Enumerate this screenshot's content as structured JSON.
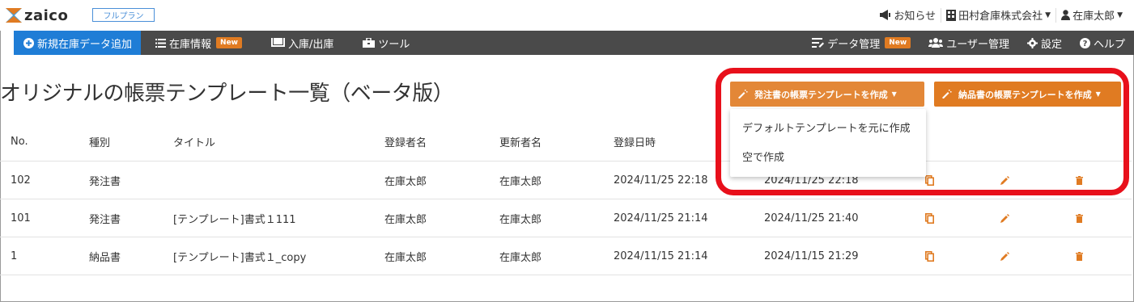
{
  "app": {
    "logo_text": "zaico",
    "plan": "フルプラン"
  },
  "topbar": {
    "notifications": "お知らせ",
    "company": "田村倉庫株式会社",
    "user": "在庫太郎"
  },
  "nav": {
    "add": "新規在庫データ追加",
    "inventory": "在庫情報",
    "inventory_badge": "New",
    "inout": "入庫/出庫",
    "tools": "ツール",
    "data_mgmt": "データ管理",
    "data_badge": "New",
    "user_mgmt": "ユーザー管理",
    "settings": "設定",
    "help": "ヘルプ"
  },
  "page": {
    "title": "オリジナルの帳票テンプレート一覧（ベータ版）"
  },
  "actions": {
    "order_btn": "発注書の帳票テンプレートを作成",
    "delivery_btn": "納品書の帳票テンプレートを作成",
    "dropdown": [
      "デフォルトテンプレートを元に作成",
      "空で作成"
    ]
  },
  "table": {
    "headers": [
      "No.",
      "種別",
      "タイトル",
      "登録者名",
      "更新者名",
      "登録日時"
    ],
    "rows": [
      {
        "no": "102",
        "type": "発注書",
        "title": "",
        "creator": "在庫太郎",
        "updater": "在庫太郎",
        "created": "2024/11/25 22:18",
        "updated": "2024/11/25 22:18"
      },
      {
        "no": "101",
        "type": "発注書",
        "title": "[テンプレート]書式１111",
        "creator": "在庫太郎",
        "updater": "在庫太郎",
        "created": "2024/11/25 21:14",
        "updated": "2024/11/25 21:40"
      },
      {
        "no": "1",
        "type": "納品書",
        "title": "[テンプレート]書式１_copy",
        "creator": "在庫太郎",
        "updater": "在庫太郎",
        "created": "2024/11/15 21:14",
        "updated": "2024/11/15 21:29"
      }
    ]
  },
  "icons": {
    "copy": "copy-icon",
    "edit": "pencil-icon",
    "delete": "trash-icon"
  },
  "colors": {
    "accent_orange": "#e07b22",
    "primary_blue": "#1f7dd6",
    "highlight_red": "#e8101b",
    "nav_bg": "#4a4a4a"
  }
}
